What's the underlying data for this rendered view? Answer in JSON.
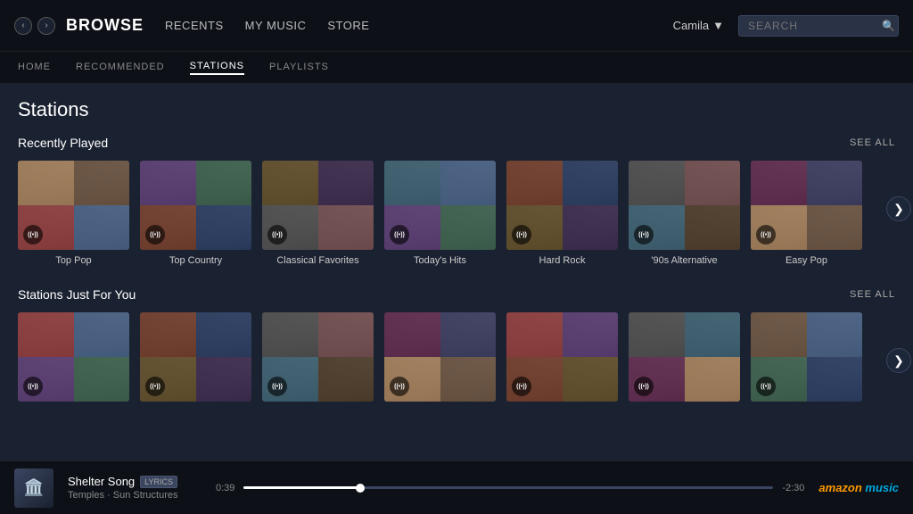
{
  "topNav": {
    "title": "BROWSE",
    "links": [
      "RECENTS",
      "MY MUSIC",
      "STORE"
    ],
    "user": "Camila",
    "searchPlaceholder": "SEARCH"
  },
  "subNav": {
    "links": [
      "HOME",
      "RECOMMENDED",
      "STATIONS",
      "PLAYLISTS"
    ],
    "active": "STATIONS"
  },
  "page": {
    "title": "Stations"
  },
  "recentlyPlayed": {
    "sectionTitle": "Recently Played",
    "seeAll": "SEE ALL",
    "stations": [
      {
        "name": "Top Pop",
        "colors": [
          "c1",
          "c2",
          "c3",
          "c4"
        ]
      },
      {
        "name": "Top Country",
        "colors": [
          "c5",
          "c6",
          "c7",
          "c8"
        ]
      },
      {
        "name": "Classical Favorites",
        "colors": [
          "c9",
          "c10",
          "c11",
          "c12"
        ]
      },
      {
        "name": "Today's Hits",
        "colors": [
          "c13",
          "c4",
          "c5",
          "c6"
        ]
      },
      {
        "name": "Hard Rock",
        "colors": [
          "c7",
          "c8",
          "c9",
          "c10"
        ]
      },
      {
        "name": "'90s Alternative",
        "colors": [
          "c11",
          "c12",
          "c13",
          "c14"
        ]
      },
      {
        "name": "Easy Pop",
        "colors": [
          "c15",
          "c16",
          "c1",
          "c2"
        ]
      }
    ]
  },
  "justForYou": {
    "sectionTitle": "Stations Just For You",
    "seeAll": "SEE ALL",
    "stations": [
      {
        "name": "",
        "colors": [
          "c3",
          "c4",
          "c5",
          "c6"
        ]
      },
      {
        "name": "",
        "colors": [
          "c7",
          "c8",
          "c9",
          "c10"
        ]
      },
      {
        "name": "",
        "colors": [
          "c11",
          "c12",
          "c13",
          "c14"
        ]
      },
      {
        "name": "",
        "colors": [
          "c15",
          "c16",
          "c1",
          "c2"
        ]
      },
      {
        "name": "",
        "colors": [
          "c3",
          "c5",
          "c7",
          "c9"
        ]
      },
      {
        "name": "",
        "colors": [
          "c11",
          "c13",
          "c15",
          "c1"
        ]
      },
      {
        "name": "",
        "colors": [
          "c2",
          "c4",
          "c6",
          "c8"
        ]
      }
    ]
  },
  "player": {
    "song": "Shelter Song",
    "artist": "Temples · Sun Structures",
    "timeElapsed": "0:39",
    "timeRemaining": "-2:30",
    "progressPercent": 22
  }
}
